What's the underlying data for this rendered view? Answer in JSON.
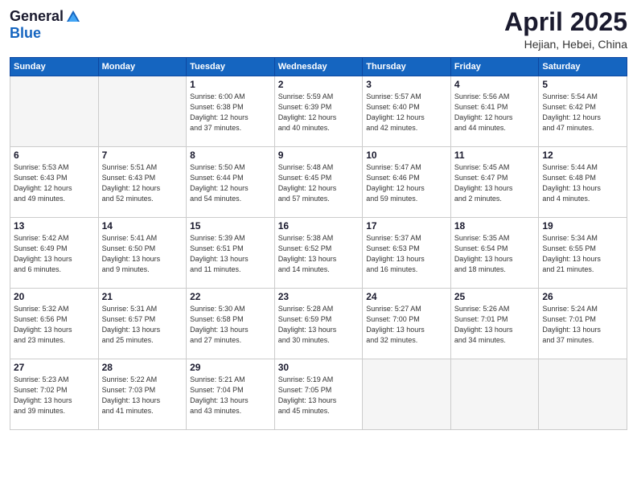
{
  "header": {
    "logo_general": "General",
    "logo_blue": "Blue",
    "title": "April 2025",
    "location": "Hejian, Hebei, China"
  },
  "weekdays": [
    "Sunday",
    "Monday",
    "Tuesday",
    "Wednesday",
    "Thursday",
    "Friday",
    "Saturday"
  ],
  "weeks": [
    [
      {
        "day": "",
        "info": ""
      },
      {
        "day": "",
        "info": ""
      },
      {
        "day": "1",
        "info": "Sunrise: 6:00 AM\nSunset: 6:38 PM\nDaylight: 12 hours\nand 37 minutes."
      },
      {
        "day": "2",
        "info": "Sunrise: 5:59 AM\nSunset: 6:39 PM\nDaylight: 12 hours\nand 40 minutes."
      },
      {
        "day": "3",
        "info": "Sunrise: 5:57 AM\nSunset: 6:40 PM\nDaylight: 12 hours\nand 42 minutes."
      },
      {
        "day": "4",
        "info": "Sunrise: 5:56 AM\nSunset: 6:41 PM\nDaylight: 12 hours\nand 44 minutes."
      },
      {
        "day": "5",
        "info": "Sunrise: 5:54 AM\nSunset: 6:42 PM\nDaylight: 12 hours\nand 47 minutes."
      }
    ],
    [
      {
        "day": "6",
        "info": "Sunrise: 5:53 AM\nSunset: 6:43 PM\nDaylight: 12 hours\nand 49 minutes."
      },
      {
        "day": "7",
        "info": "Sunrise: 5:51 AM\nSunset: 6:43 PM\nDaylight: 12 hours\nand 52 minutes."
      },
      {
        "day": "8",
        "info": "Sunrise: 5:50 AM\nSunset: 6:44 PM\nDaylight: 12 hours\nand 54 minutes."
      },
      {
        "day": "9",
        "info": "Sunrise: 5:48 AM\nSunset: 6:45 PM\nDaylight: 12 hours\nand 57 minutes."
      },
      {
        "day": "10",
        "info": "Sunrise: 5:47 AM\nSunset: 6:46 PM\nDaylight: 12 hours\nand 59 minutes."
      },
      {
        "day": "11",
        "info": "Sunrise: 5:45 AM\nSunset: 6:47 PM\nDaylight: 13 hours\nand 2 minutes."
      },
      {
        "day": "12",
        "info": "Sunrise: 5:44 AM\nSunset: 6:48 PM\nDaylight: 13 hours\nand 4 minutes."
      }
    ],
    [
      {
        "day": "13",
        "info": "Sunrise: 5:42 AM\nSunset: 6:49 PM\nDaylight: 13 hours\nand 6 minutes."
      },
      {
        "day": "14",
        "info": "Sunrise: 5:41 AM\nSunset: 6:50 PM\nDaylight: 13 hours\nand 9 minutes."
      },
      {
        "day": "15",
        "info": "Sunrise: 5:39 AM\nSunset: 6:51 PM\nDaylight: 13 hours\nand 11 minutes."
      },
      {
        "day": "16",
        "info": "Sunrise: 5:38 AM\nSunset: 6:52 PM\nDaylight: 13 hours\nand 14 minutes."
      },
      {
        "day": "17",
        "info": "Sunrise: 5:37 AM\nSunset: 6:53 PM\nDaylight: 13 hours\nand 16 minutes."
      },
      {
        "day": "18",
        "info": "Sunrise: 5:35 AM\nSunset: 6:54 PM\nDaylight: 13 hours\nand 18 minutes."
      },
      {
        "day": "19",
        "info": "Sunrise: 5:34 AM\nSunset: 6:55 PM\nDaylight: 13 hours\nand 21 minutes."
      }
    ],
    [
      {
        "day": "20",
        "info": "Sunrise: 5:32 AM\nSunset: 6:56 PM\nDaylight: 13 hours\nand 23 minutes."
      },
      {
        "day": "21",
        "info": "Sunrise: 5:31 AM\nSunset: 6:57 PM\nDaylight: 13 hours\nand 25 minutes."
      },
      {
        "day": "22",
        "info": "Sunrise: 5:30 AM\nSunset: 6:58 PM\nDaylight: 13 hours\nand 27 minutes."
      },
      {
        "day": "23",
        "info": "Sunrise: 5:28 AM\nSunset: 6:59 PM\nDaylight: 13 hours\nand 30 minutes."
      },
      {
        "day": "24",
        "info": "Sunrise: 5:27 AM\nSunset: 7:00 PM\nDaylight: 13 hours\nand 32 minutes."
      },
      {
        "day": "25",
        "info": "Sunrise: 5:26 AM\nSunset: 7:01 PM\nDaylight: 13 hours\nand 34 minutes."
      },
      {
        "day": "26",
        "info": "Sunrise: 5:24 AM\nSunset: 7:01 PM\nDaylight: 13 hours\nand 37 minutes."
      }
    ],
    [
      {
        "day": "27",
        "info": "Sunrise: 5:23 AM\nSunset: 7:02 PM\nDaylight: 13 hours\nand 39 minutes."
      },
      {
        "day": "28",
        "info": "Sunrise: 5:22 AM\nSunset: 7:03 PM\nDaylight: 13 hours\nand 41 minutes."
      },
      {
        "day": "29",
        "info": "Sunrise: 5:21 AM\nSunset: 7:04 PM\nDaylight: 13 hours\nand 43 minutes."
      },
      {
        "day": "30",
        "info": "Sunrise: 5:19 AM\nSunset: 7:05 PM\nDaylight: 13 hours\nand 45 minutes."
      },
      {
        "day": "",
        "info": ""
      },
      {
        "day": "",
        "info": ""
      },
      {
        "day": "",
        "info": ""
      }
    ]
  ]
}
